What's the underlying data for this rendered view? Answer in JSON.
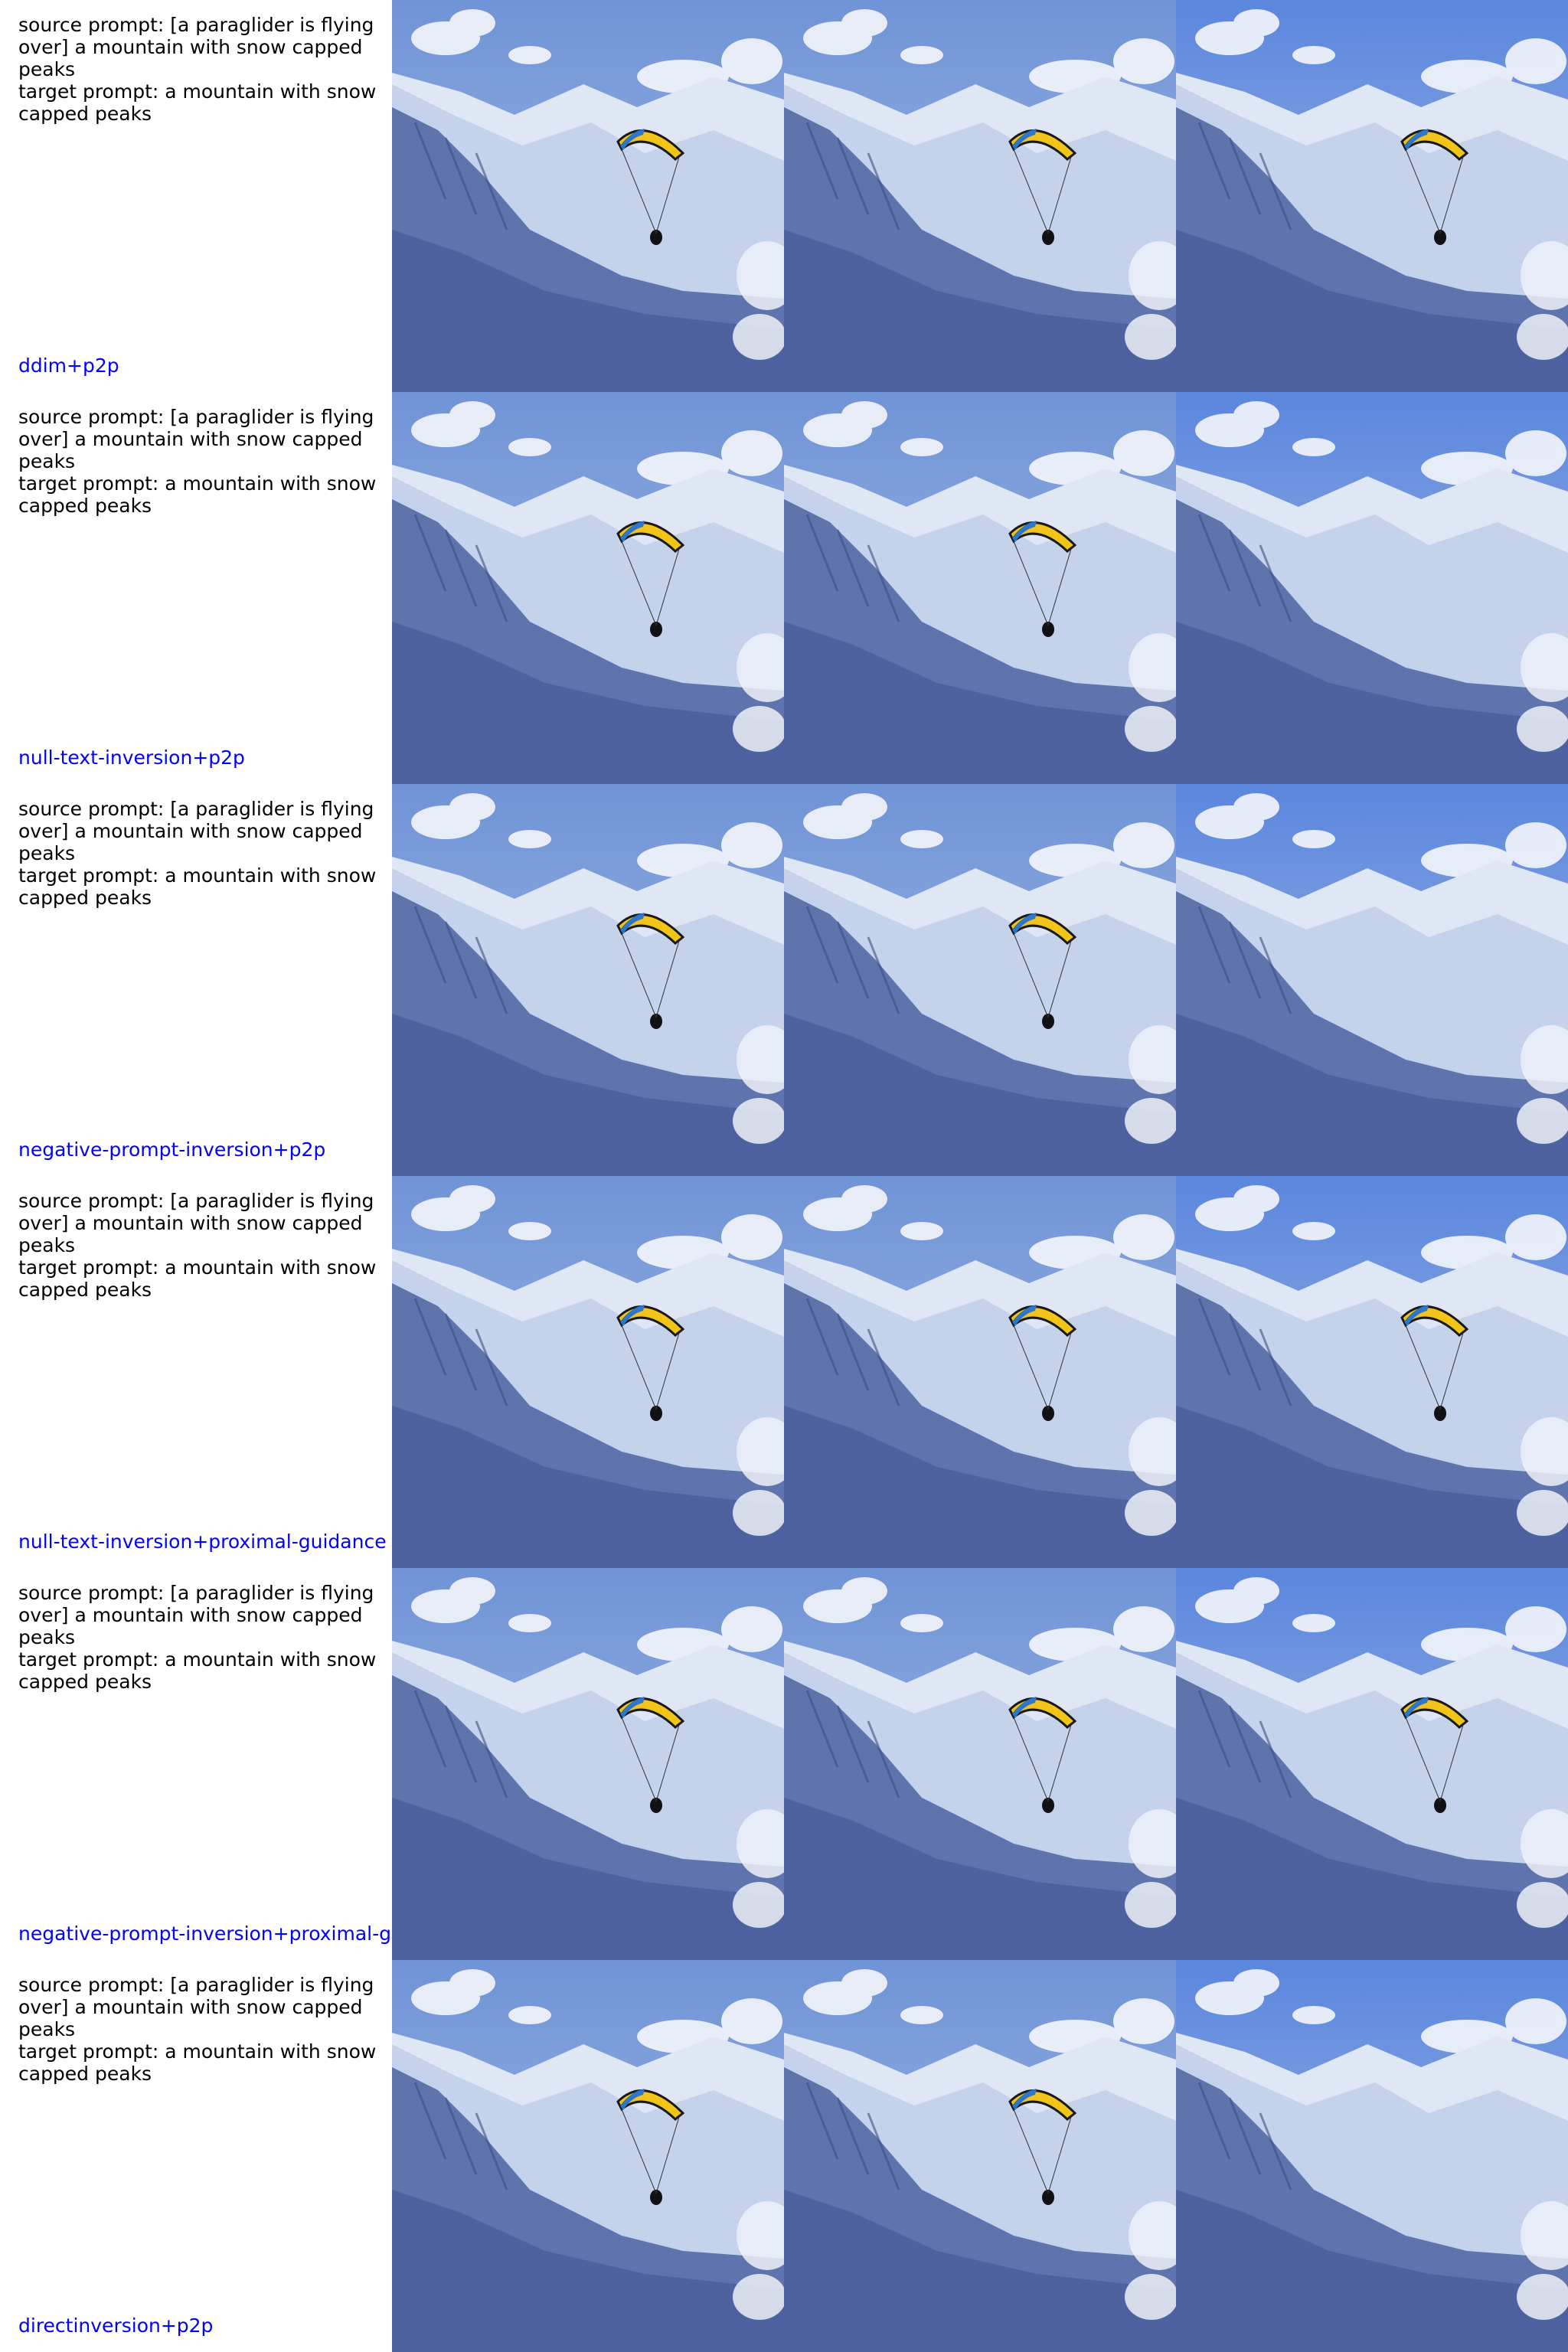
{
  "rows": [
    {
      "source_prompt": "source prompt: [a paraglider is flying over] a mountain with snow capped peaks",
      "target_prompt": "target prompt: a mountain with snow capped peaks",
      "method": "ddim+p2p"
    },
    {
      "source_prompt": "source prompt: [a paraglider is flying over] a mountain with snow capped peaks",
      "target_prompt": "target prompt: a mountain with snow capped peaks",
      "method": "null-text-inversion+p2p"
    },
    {
      "source_prompt": "source prompt: [a paraglider is flying over] a mountain with snow capped peaks",
      "target_prompt": "target prompt: a mountain with snow capped peaks",
      "method": "negative-prompt-inversion+p2p"
    },
    {
      "source_prompt": "source prompt: [a paraglider is flying over] a mountain with snow capped peaks",
      "target_prompt": "target prompt: a mountain with snow capped peaks",
      "method": "null-text-inversion+proximal-guidance"
    },
    {
      "source_prompt": "source prompt: [a paraglider is flying over] a mountain with snow capped peaks",
      "target_prompt": "target prompt: a mountain with snow capped peaks",
      "method": "negative-prompt-inversion+proximal-g"
    },
    {
      "source_prompt": "source prompt: [a paraglider is flying over] a mountain with snow capped peaks",
      "target_prompt": "target prompt: a mountain with snow capped peaks",
      "method": "directinversion+p2p"
    }
  ],
  "colors": {
    "method_label": "#0000ff",
    "prompt_text": "#000000",
    "sky": "#6f93d6",
    "glider_yellow": "#f2c41a",
    "glider_blue": "#2c78c8"
  }
}
